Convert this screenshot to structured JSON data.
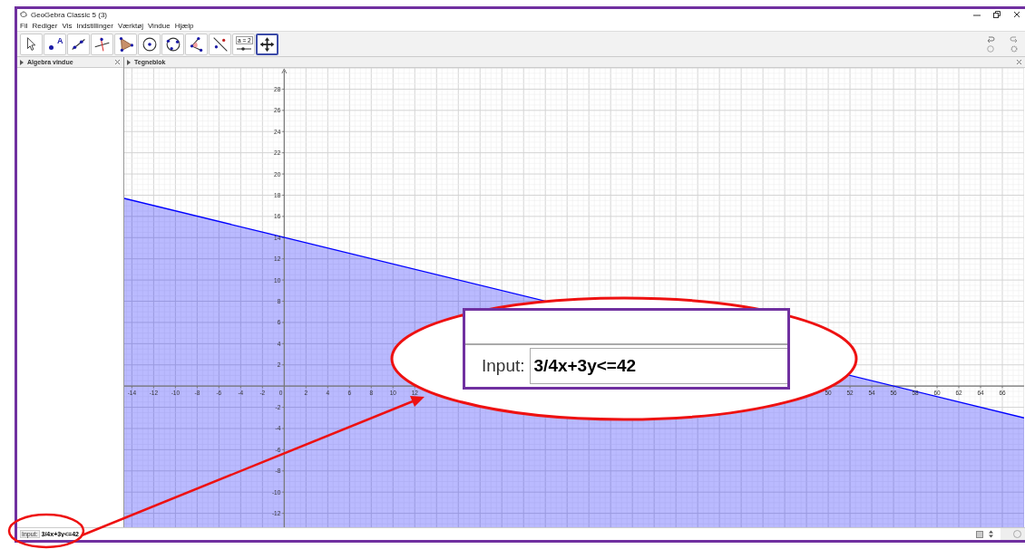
{
  "window": {
    "title": "GeoGebra Classic 5 (3)"
  },
  "menu": [
    "Fil",
    "Rediger",
    "Vis",
    "Indstillinger",
    "Værktøj",
    "Vindue",
    "Hjælp"
  ],
  "toolbar": {
    "tools": [
      {
        "kind": "move",
        "selected": false
      },
      {
        "kind": "point",
        "label": "A",
        "selected": false
      },
      {
        "kind": "line",
        "selected": false
      },
      {
        "kind": "perpendicular",
        "selected": false
      },
      {
        "kind": "polygon",
        "selected": false
      },
      {
        "kind": "circle",
        "selected": false
      },
      {
        "kind": "conic",
        "selected": false
      },
      {
        "kind": "angle",
        "selected": false
      },
      {
        "kind": "reflect",
        "selected": false
      },
      {
        "kind": "slider",
        "label": "a = 2",
        "selected": false
      },
      {
        "kind": "pan",
        "selected": true
      }
    ]
  },
  "algebra_panel": {
    "title": "Algebra vindue"
  },
  "graphics_panel": {
    "title": "Tegneblok",
    "origin_label": "0",
    "chart_data": {
      "type": "line",
      "grid": true,
      "x": [
        -14.7,
        68
      ],
      "series": [
        {
          "color": "#0000ff",
          "values": [
            17.7,
            -3
          ]
        }
      ],
      "xlim": [
        -14.7,
        68
      ],
      "ylim": [
        -13.4,
        30
      ],
      "xticks": [
        -14,
        -12,
        -10,
        -8,
        -6,
        -4,
        -2,
        2,
        4,
        6,
        8,
        10,
        12,
        50,
        52,
        54,
        56,
        58,
        60,
        62,
        64,
        66
      ],
      "yticks": [
        28,
        26,
        24,
        22,
        20,
        18,
        16,
        14,
        12,
        10,
        8,
        6,
        4,
        2,
        -2,
        -4,
        -6,
        -8,
        -10,
        -12
      ]
    }
  },
  "input_bar": {
    "label": "Input:",
    "value": "3/4x+3y<=42"
  },
  "callout": {
    "label": "Input:",
    "value": "3/4x+3y<=42"
  }
}
